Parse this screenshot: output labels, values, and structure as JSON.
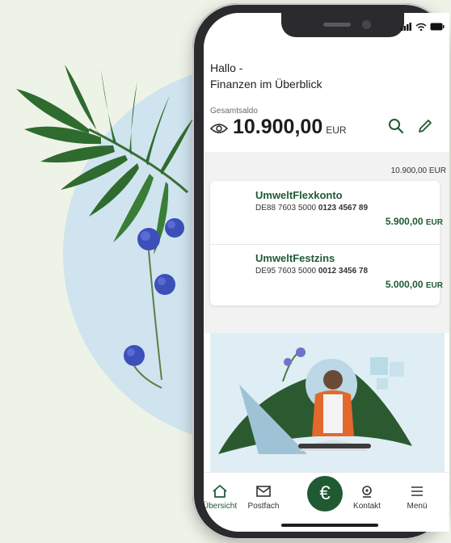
{
  "greeting": {
    "line1": "Hallo -",
    "line2": "Finanzen im Überblick"
  },
  "balance": {
    "label": "Gesamtsaldo",
    "amount": "10.900,00",
    "currency": "EUR"
  },
  "summary": {
    "total": "10.900,00 EUR"
  },
  "accounts": [
    {
      "name": "UmweltFlexkonto",
      "iban_prefix": "DE88 7603 5000",
      "iban_suffix": "0123 4567 89",
      "amount": "5.900,00",
      "currency": "EUR"
    },
    {
      "name": "UmweltFestzins",
      "iban_prefix": "DE95 7603 5000",
      "iban_suffix": "0012 3456 78",
      "amount": "5.000,00",
      "currency": "EUR"
    }
  ],
  "tabbar": {
    "overview": "Übersicht",
    "inbox": "Postfach",
    "center": "€",
    "contact": "Kontakt",
    "menu": "Menü"
  },
  "colors": {
    "brand_green": "#1f5a32",
    "background": "#eef3e7",
    "circle": "#cfe4ef"
  },
  "icons": {
    "eye": "eye-icon",
    "search": "search-icon",
    "edit": "pencil-icon",
    "home": "home-icon",
    "mail": "mail-icon",
    "contact": "headset-icon",
    "menu": "hamburger-icon"
  }
}
